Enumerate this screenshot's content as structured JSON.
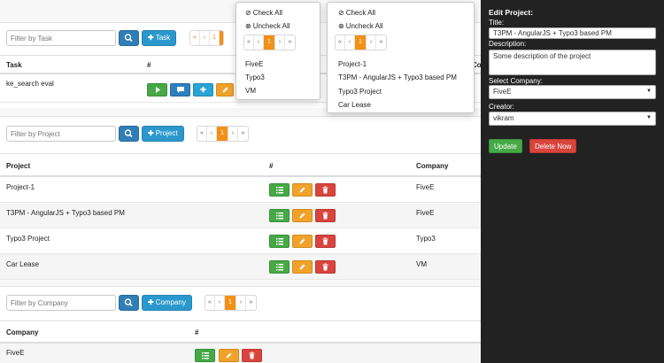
{
  "tasks": {
    "filter_placeholder": "Filter by Task",
    "add_label": "Task",
    "pager": [
      "«",
      "‹",
      "1"
    ],
    "headers": [
      "Task",
      "#",
      "Co"
    ],
    "rows": [
      {
        "name": "ke_search eval"
      }
    ]
  },
  "projects": {
    "filter_placeholder": "Filter by Project",
    "add_label": "Project",
    "pager": [
      "«",
      "‹",
      "1",
      "›",
      "»"
    ],
    "headers": [
      "Project",
      "#",
      "Company"
    ],
    "rows": [
      {
        "name": "Project-1",
        "company": "FiveE"
      },
      {
        "name": "T3PM - AngularJS + Typo3 based PM",
        "company": "FiveE"
      },
      {
        "name": "Typo3 Project",
        "company": "Typo3"
      },
      {
        "name": "Car Lease",
        "company": "VM"
      }
    ]
  },
  "companies": {
    "filter_placeholder": "Filter by Company",
    "add_label": "Company",
    "pager": [
      "«",
      "‹",
      "1",
      "›",
      "»"
    ],
    "headers": [
      "Company",
      "#"
    ],
    "rows": [
      {
        "name": "FiveE"
      }
    ]
  },
  "company_dropdown": {
    "check_all": "Check All",
    "uncheck_all": "Uncheck All",
    "pager": [
      "«",
      "‹",
      "1",
      "›",
      "»"
    ],
    "options": [
      "FiveE",
      "Typo3",
      "VM"
    ]
  },
  "project_dropdown": {
    "check_all": "Check All",
    "uncheck_all": "Uncheck All",
    "pager": [
      "«",
      "‹",
      "1",
      "›",
      "»"
    ],
    "options": [
      "Project-1",
      "T3PM - AngularJS + Typo3 based PM",
      "Typo3 Project",
      "Car Lease"
    ]
  },
  "edit_project": {
    "heading": "Edit Project:",
    "title_label": "Title:",
    "title_value": "T3PM - AngularJS + Typo3 based PM",
    "description_label": "Description:",
    "description_value": "Some description of the project",
    "company_label": "Select Company:",
    "company_value": "FiveE",
    "creator_label": "Creator:",
    "creator_value": "vikram",
    "update_label": "Update",
    "delete_label": "Delete Now"
  },
  "colors": {
    "accent_orange": "#f39016",
    "primary_blue": "#2b98cd",
    "success_green": "#46a946",
    "danger_red": "#d9443d",
    "sidebar_bg": "#222222"
  }
}
